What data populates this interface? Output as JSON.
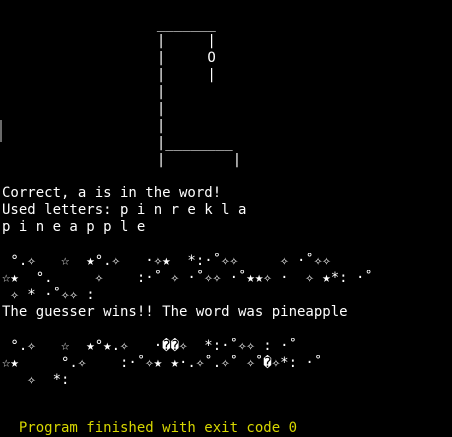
{
  "terminal": {
    "gallows": [
      "  _______",
      "  |     |",
      "  |     O",
      "  |     |",
      "  |",
      "  |",
      "  |",
      "  |________",
      "  |        |"
    ],
    "status": {
      "correct_message": "Correct, a is in the word!",
      "used_letters": "Used letters: p i n r e k l a",
      "word_progress": "p i n e a p p l e"
    },
    "sparkles_top": [
      " °.✧   ☆  ★°.✧   ·✧★  *:·˚✧✧     ✧ ·˚✧✧",
      "☆★  °.     ✧    :·˚ ✧ ·˚✧✧ ·˚★★✧ ·  ✧ ★*: ·˚",
      " ✧ * ·˚✧✧ :"
    ],
    "win_message": "The guesser wins!! The word was pineapple",
    "sparkles_bottom": [
      " °.✧   ☆  ★°★.✧   ·��✧  *:·˚✧✧ : ·˚",
      "☆★     °.✧    :·˚✧★ ★·.✧˚.✧˚ ✧˚�✧*: ·˚",
      "   ✧  *:"
    ],
    "prompt_partial": "  Program finished with exit code 0",
    "colors": {
      "background": "#000000",
      "foreground": "#ffffff",
      "prompt": "#d7d700"
    }
  }
}
